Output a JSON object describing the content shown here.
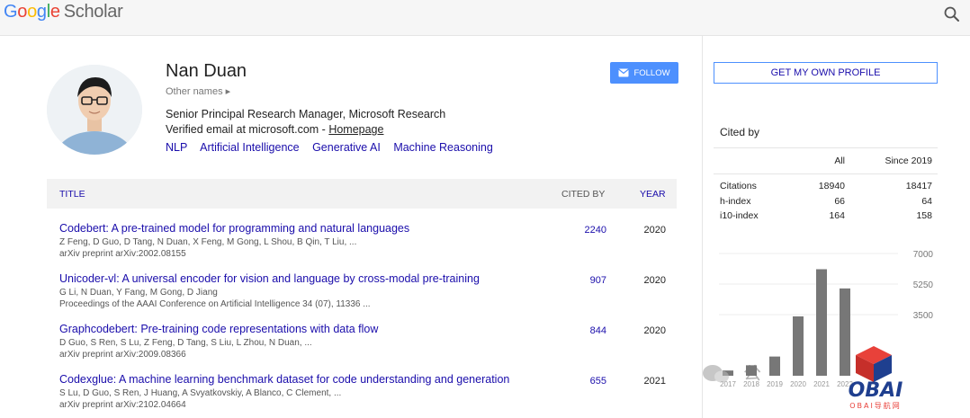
{
  "header": {
    "logo_parts": [
      "G",
      "o",
      "o",
      "g",
      "l",
      "e"
    ],
    "logo_suffix": "Scholar"
  },
  "profile": {
    "name": "Nan Duan",
    "other_names": "Other names ▸",
    "affiliation": "Senior Principal Research Manager, Microsoft Research",
    "email_prefix": "Verified email at microsoft.com - ",
    "homepage_label": "Homepage",
    "interests": [
      "NLP",
      "Artificial Intelligence",
      "Generative AI",
      "Machine Reasoning"
    ],
    "follow_label": "FOLLOW",
    "get_profile_label": "GET MY OWN PROFILE"
  },
  "table": {
    "headers": {
      "title": "TITLE",
      "cited_by": "CITED BY",
      "year": "YEAR"
    },
    "rows": [
      {
        "title": "Codebert: A pre-trained model for programming and natural languages",
        "authors": "Z Feng, D Guo, D Tang, N Duan, X Feng, M Gong, L Shou, B Qin, T Liu, ...",
        "venue": "arXiv preprint arXiv:2002.08155",
        "cited": "2240",
        "year": "2020"
      },
      {
        "title": "Unicoder-vl: A universal encoder for vision and language by cross-modal pre-training",
        "authors": "G Li, N Duan, Y Fang, M Gong, D Jiang",
        "venue": "Proceedings of the AAAI Conference on Artificial Intelligence 34 (07), 11336 ...",
        "cited": "907",
        "year": "2020"
      },
      {
        "title": "Graphcodebert: Pre-training code representations with data flow",
        "authors": "D Guo, S Ren, S Lu, Z Feng, D Tang, S Liu, L Zhou, N Duan, ...",
        "venue": "arXiv preprint arXiv:2009.08366",
        "cited": "844",
        "year": "2020"
      },
      {
        "title": "Codexglue: A machine learning benchmark dataset for code understanding and generation",
        "authors": "S Lu, D Guo, S Ren, J Huang, A Svyatkovskiy, A Blanco, C Clement, ...",
        "venue": "arXiv preprint arXiv:2102.04664",
        "cited": "655",
        "year": "2021"
      }
    ]
  },
  "cited_by": {
    "title": "Cited by",
    "col_all": "All",
    "col_since": "Since 2019",
    "rows": [
      {
        "label": "Citations",
        "all": "18940",
        "since": "18417"
      },
      {
        "label": "h-index",
        "all": "66",
        "since": "64"
      },
      {
        "label": "i10-index",
        "all": "164",
        "since": "158"
      }
    ]
  },
  "chart_data": {
    "type": "bar",
    "categories": [
      "2017",
      "2018",
      "2019",
      "2020",
      "2021",
      "2022"
    ],
    "values": [
      300,
      600,
      1100,
      3400,
      6100,
      5000
    ],
    "y_ticks": [
      "7000",
      "5250",
      "3500"
    ],
    "ylim": [
      0,
      7000
    ],
    "bar_color": "#777777",
    "grid": true
  },
  "watermark": {
    "brand": "OBAI",
    "subtitle": "OBAI导航网",
    "wechat_text": "公"
  },
  "colors": {
    "link": "#1a0dab",
    "button": "#4d90fe",
    "brand_red": "#e8413a"
  }
}
